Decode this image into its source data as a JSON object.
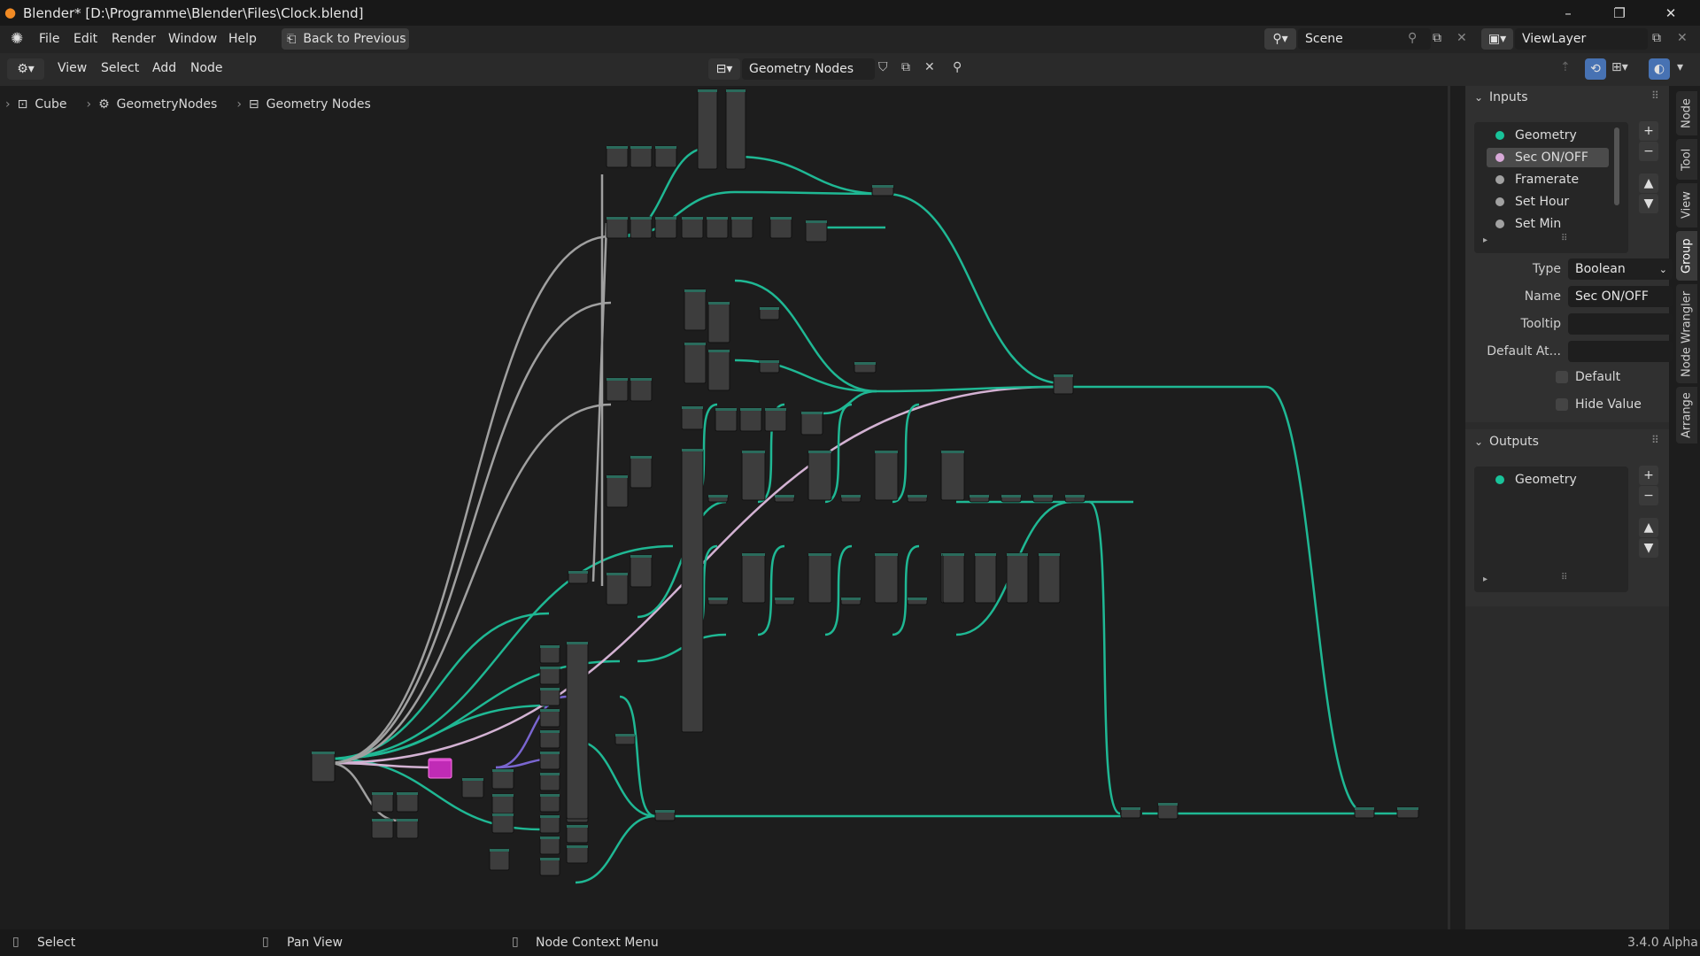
{
  "window": {
    "title": "Blender* [D:\\Programme\\Blender\\Files\\Clock.blend]",
    "minimize": "–",
    "restore": "❐",
    "close": "✕"
  },
  "topbar": {
    "menus": [
      "File",
      "Edit",
      "Render",
      "Window",
      "Help"
    ],
    "back_button": "Back to Previous",
    "scene": "Scene",
    "view_layer": "ViewLayer"
  },
  "editor_header": {
    "menus": [
      "View",
      "Select",
      "Add",
      "Node"
    ],
    "node_tree": "Geometry Nodes"
  },
  "breadcrumb": [
    "Cube",
    "GeometryNodes",
    "Geometry Nodes"
  ],
  "side_tabs": [
    "Node",
    "Tool",
    "View",
    "Group",
    "Node Wrangler",
    "Arrange"
  ],
  "inputs_panel": {
    "title": "Inputs",
    "sockets": [
      {
        "name": "Geometry",
        "color": "#19c39a"
      },
      {
        "name": "Sec ON/OFF",
        "color": "#d9a9d9"
      },
      {
        "name": "Framerate",
        "color": "#a1a1a1"
      },
      {
        "name": "Set Hour",
        "color": "#a1a1a1"
      },
      {
        "name": "Set Min",
        "color": "#a1a1a1"
      }
    ],
    "type_label": "Type",
    "type_value": "Boolean",
    "name_label": "Name",
    "name_value": "Sec ON/OFF",
    "tooltip_label": "Tooltip",
    "tooltip_value": "",
    "default_attr_label": "Default At...",
    "default_attr_value": "",
    "default_check": "Default",
    "hide_value_check": "Hide Value"
  },
  "outputs_panel": {
    "title": "Outputs",
    "sockets": [
      {
        "name": "Geometry",
        "color": "#19c39a"
      }
    ]
  },
  "status": {
    "select": "Select",
    "pan": "Pan View",
    "context": "Node Context Menu",
    "version": "3.4.0 Alpha"
  },
  "colors": {
    "geometry_link": "#1fb894",
    "boolean_link": "#d3b2d3",
    "float_link": "#a0a0a0",
    "vector_link": "#7a66d0",
    "selected_node": "#c02bb6"
  }
}
